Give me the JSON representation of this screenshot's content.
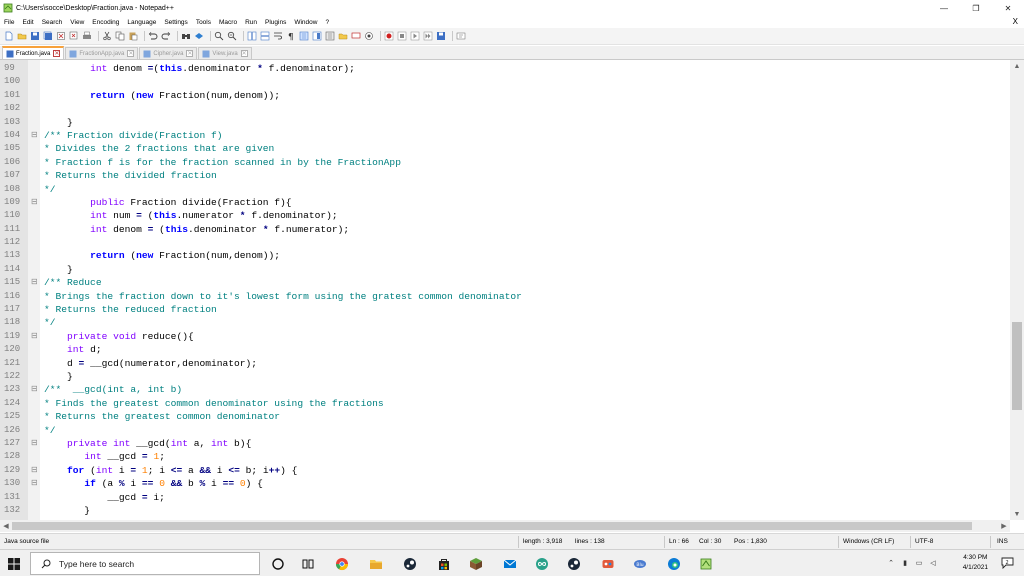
{
  "window": {
    "title": "C:\\Users\\socce\\Desktop\\Fraction.java - Notepad++",
    "minimize": "—",
    "maximize": "❐",
    "close": "✕"
  },
  "menu": {
    "items": [
      "File",
      "Edit",
      "Search",
      "View",
      "Encoding",
      "Language",
      "Settings",
      "Tools",
      "Macro",
      "Run",
      "Plugins",
      "Window",
      "?"
    ],
    "close_doc": "X"
  },
  "tabs": [
    {
      "label": "Fraction.java",
      "active": true
    },
    {
      "label": "FractionApp.java",
      "active": false
    },
    {
      "label": "Cipher.java",
      "active": false
    },
    {
      "label": "View.java",
      "active": false
    }
  ],
  "editor": {
    "lines": [
      {
        "n": "99",
        "fold": "",
        "html": "        <span class='ty'>int</span> denom <span class='op'>=</span>(<span class='kw'>this</span>.denominator <span class='op'>*</span> f.denominator);"
      },
      {
        "n": "100",
        "fold": "",
        "html": ""
      },
      {
        "n": "101",
        "fold": "",
        "html": "        <span class='kw'>return</span> (<span class='kw'>new</span> Fraction(num,denom));"
      },
      {
        "n": "102",
        "fold": "",
        "html": ""
      },
      {
        "n": "103",
        "fold": "",
        "html": "    }"
      },
      {
        "n": "104",
        "fold": "⊟",
        "html": "<span class='cm'>/** Fraction divide(Fraction f)</span>"
      },
      {
        "n": "105",
        "fold": "",
        "html": "<span class='cm'>* Divides the 2 fractions that are given</span>"
      },
      {
        "n": "106",
        "fold": "",
        "html": "<span class='cm'>* Fraction f is for the fraction scanned in by the FractionApp</span>"
      },
      {
        "n": "107",
        "fold": "",
        "html": "<span class='cm'>* Returns the divided fraction</span>"
      },
      {
        "n": "108",
        "fold": "",
        "html": "<span class='cm'>*/</span>"
      },
      {
        "n": "109",
        "fold": "⊟",
        "html": "        <span class='ty'>public</span> Fraction divide(Fraction f){"
      },
      {
        "n": "110",
        "fold": "",
        "html": "        <span class='ty'>int</span> num <span class='op'>=</span> (<span class='kw'>this</span>.numerator <span class='op'>*</span> f.denominator);"
      },
      {
        "n": "111",
        "fold": "",
        "html": "        <span class='ty'>int</span> denom <span class='op'>=</span> (<span class='kw'>this</span>.denominator <span class='op'>*</span> f.numerator);"
      },
      {
        "n": "112",
        "fold": "",
        "html": ""
      },
      {
        "n": "113",
        "fold": "",
        "html": "        <span class='kw'>return</span> (<span class='kw'>new</span> Fraction(num,denom));"
      },
      {
        "n": "114",
        "fold": "",
        "html": "    }"
      },
      {
        "n": "115",
        "fold": "⊟",
        "html": "<span class='cm'>/** Reduce</span>"
      },
      {
        "n": "116",
        "fold": "",
        "html": "<span class='cm'>* Brings the fraction down to it's lowest form using the gratest common denominator</span>"
      },
      {
        "n": "117",
        "fold": "",
        "html": "<span class='cm'>* Returns the reduced fraction</span>"
      },
      {
        "n": "118",
        "fold": "",
        "html": "<span class='cm'>*/</span>"
      },
      {
        "n": "119",
        "fold": "⊟",
        "html": "    <span class='ty'>private</span> <span class='ty'>void</span> reduce(){"
      },
      {
        "n": "120",
        "fold": "",
        "html": "    <span class='ty'>int</span> d;"
      },
      {
        "n": "121",
        "fold": "",
        "html": "    d <span class='op'>=</span> __gcd(numerator,denominator);"
      },
      {
        "n": "122",
        "fold": "",
        "html": "    }"
      },
      {
        "n": "123",
        "fold": "⊟",
        "html": "<span class='cm'>/**  __gcd(int a, int b)</span>"
      },
      {
        "n": "124",
        "fold": "",
        "html": "<span class='cm'>* Finds the greatest common denominator using the fractions</span>"
      },
      {
        "n": "125",
        "fold": "",
        "html": "<span class='cm'>* Returns the greatest common denominator</span>"
      },
      {
        "n": "126",
        "fold": "",
        "html": "<span class='cm'>*/</span>"
      },
      {
        "n": "127",
        "fold": "⊟",
        "html": "    <span class='ty'>private</span> <span class='ty'>int</span> __gcd(<span class='ty'>int</span> a, <span class='ty'>int</span> b){"
      },
      {
        "n": "128",
        "fold": "",
        "html": "       <span class='ty'>int</span> __gcd <span class='op'>=</span> <span class='num'>1</span>;"
      },
      {
        "n": "129",
        "fold": "⊟",
        "html": "    <span class='kw'>for</span> (<span class='ty'>int</span> i <span class='op'>=</span> <span class='num'>1</span>; i <span class='op'>&lt;=</span> a <span class='op'>&amp;&amp;</span> i <span class='op'>&lt;=</span> b; i<span class='op'>++</span>) {"
      },
      {
        "n": "130",
        "fold": "⊟",
        "html": "       <span class='kw'>if</span> (a <span class='op'>%</span> i <span class='op'>==</span> <span class='num'>0</span> <span class='op'>&amp;&amp;</span> b <span class='op'>%</span> i <span class='op'>==</span> <span class='num'>0</span>) {"
      },
      {
        "n": "131",
        "fold": "",
        "html": "           __gcd <span class='op'>=</span> i;"
      },
      {
        "n": "132",
        "fold": "",
        "html": "       }"
      }
    ]
  },
  "status": {
    "filetype": "Java source file",
    "length": "length : 3,918",
    "lines": "lines : 138",
    "ln": "Ln : 66",
    "col": "Col : 30",
    "pos": "Pos : 1,830",
    "eol": "Windows (CR LF)",
    "encoding": "UTF-8",
    "mode": "INS"
  },
  "taskbar": {
    "search_placeholder": "Type here to search",
    "time": "4:30 PM",
    "date": "4/1/2021",
    "notifications": "2"
  },
  "colors": {
    "keyword": "#0000ff",
    "type": "#8000ff",
    "comment": "#008080",
    "number": "#ff8000",
    "active_tab_accent": "#f7a13a"
  }
}
